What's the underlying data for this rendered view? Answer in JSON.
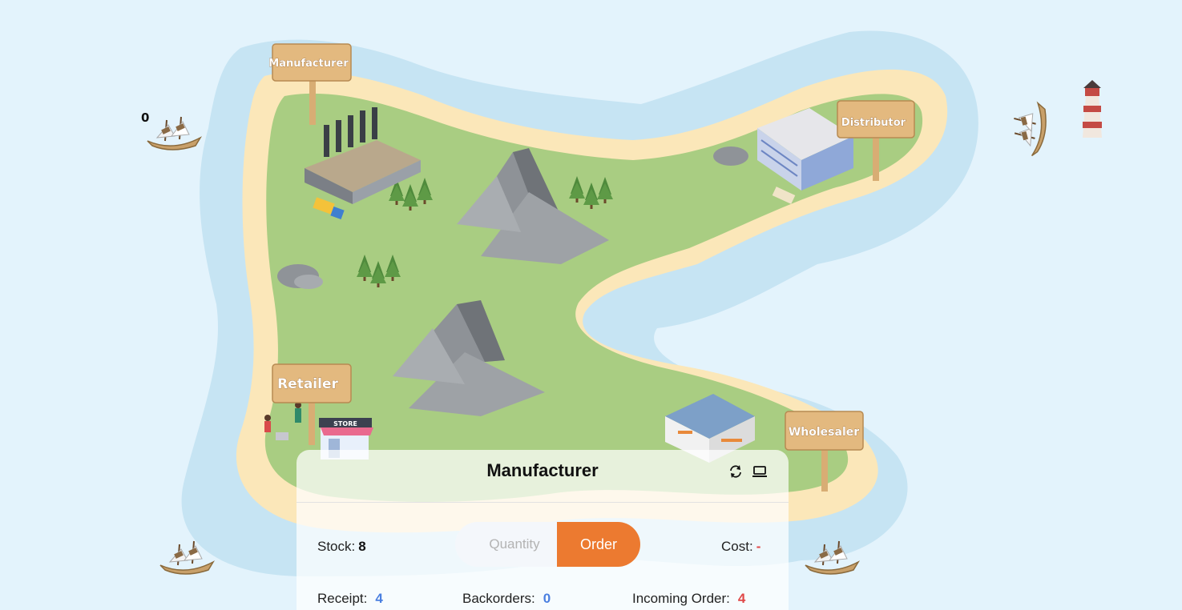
{
  "map": {
    "signs": {
      "manufacturer": "Manufacturer",
      "distributor": "Distributor",
      "retailer": "Retailer",
      "wholesaler": "Wholesaler"
    },
    "store_sign": "STORE",
    "ship_counter": "0"
  },
  "panel": {
    "title": "Manufacturer",
    "refresh_icon": "refresh-icon",
    "screen_icon": "laptop-icon",
    "stock_label": "Stock:",
    "stock_value": "8",
    "quantity_placeholder": "Quantity",
    "order_label": "Order",
    "cost_label": "Cost:",
    "cost_value": "-",
    "receipt_label": "Receipt:",
    "receipt_value": "4",
    "backorders_label": "Backorders:",
    "backorders_value": "0",
    "incoming_label": "Incoming Order:",
    "incoming_value": "4"
  },
  "colors": {
    "sea": "#e3f3fc",
    "shallow_water": "#c6e4f3",
    "sand": "#fbe7b9",
    "grass": "#a9cd82",
    "accent_order": "#ec7a30",
    "value_blue": "#4a7fe0",
    "value_red": "#e04848"
  }
}
